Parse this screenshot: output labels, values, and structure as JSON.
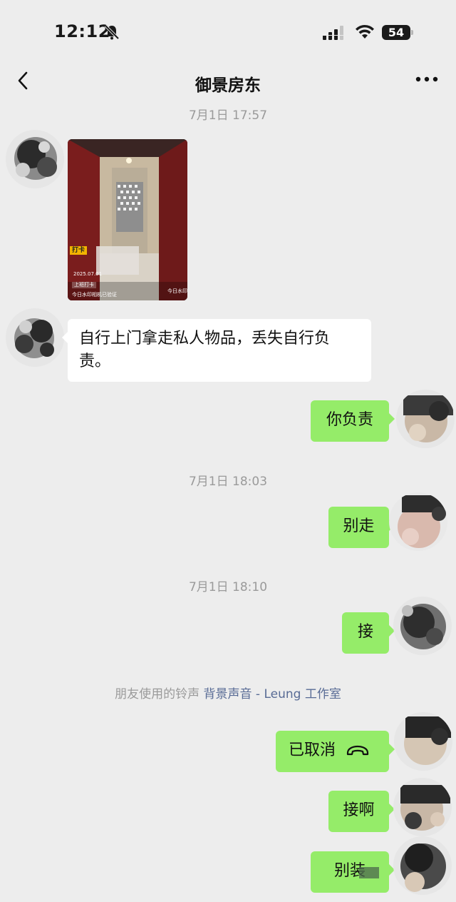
{
  "status_bar": {
    "time": "12:12",
    "battery": "54"
  },
  "header": {
    "title": "御景房东"
  },
  "timestamps": [
    "7月1日 17:57",
    "7月1日 18:03",
    "7月1日 18:10"
  ],
  "image_message": {
    "punch_tag": "打卡",
    "date_text": "2025.07.01",
    "checkin_label": "上班打卡",
    "footer_text": "今日水印相机已验证",
    "watermark_brand": "今日水印"
  },
  "messages": {
    "landlord_text": "自行上门拿走私人物品，丢失自行负责。",
    "you_responsible": "你负责",
    "dont_go": "别走",
    "answer": "接",
    "cancelled": "已取消",
    "answer_ah": "接啊",
    "stop_pretending": "别装"
  },
  "ringtone_notice": {
    "prefix": "朋友使用的铃声",
    "song": "背景声音 - Leung 工作室"
  },
  "icons": {
    "bell": "bell-muted-icon",
    "signal": "cellular-signal-icon",
    "wifi": "wifi-icon",
    "back": "chevron-left-icon",
    "more": "more-dots-icon",
    "call": "hang-up-phone-icon"
  },
  "colors": {
    "background": "#ededed",
    "sent_bubble": "#95ec69",
    "received_bubble": "#ffffff",
    "link": "#586b95"
  }
}
